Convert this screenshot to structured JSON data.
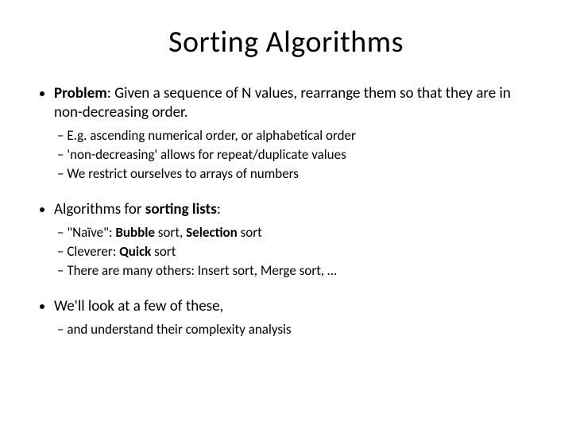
{
  "title": "Sorting Algorithms",
  "bullets": [
    {
      "prefix_bold": "Problem",
      "rest": ": Given a sequence of N values, rearrange them so that they are in non-decreasing order.",
      "sub": [
        "E.g. ascending numerical order, or alphabetical order",
        "'non-decreasing' allows for repeat/duplicate values",
        "We restrict ourselves to arrays of numbers"
      ]
    },
    {
      "pre": "Algorithms for ",
      "mid_bold": "sorting lists",
      "post": ":",
      "sub_rich": [
        {
          "pre": "\"Naïve\": ",
          "b1": "Bubble",
          "mid": " sort, ",
          "b2": "Selection",
          "post": " sort"
        },
        {
          "pre": "Cleverer: ",
          "b1": "Quick",
          "mid": " sort",
          "b2": "",
          "post": ""
        },
        {
          "pre": "There are many others: Insert sort, Merge sort, …",
          "b1": "",
          "mid": "",
          "b2": "",
          "post": ""
        }
      ]
    },
    {
      "plain": "We'll look at a few of these,",
      "sub": [
        "and understand their complexity analysis"
      ]
    }
  ]
}
